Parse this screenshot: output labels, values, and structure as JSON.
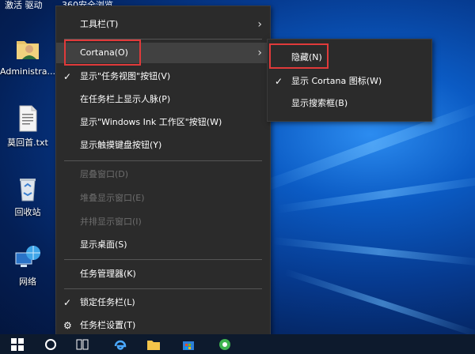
{
  "desktop": {
    "top_labels": [
      "激活 驱动",
      "360安全浏览"
    ],
    "icons": [
      {
        "label": "Administra..."
      },
      {
        "label": "莫回首.txt"
      },
      {
        "label": "回收站"
      },
      {
        "label": "网络"
      }
    ]
  },
  "context_menu": {
    "items": [
      {
        "label": "工具栏(T)",
        "submenu": true
      },
      {
        "label": "Cortana(O)",
        "submenu": true,
        "highlighted": true
      },
      {
        "label": "显示\"任务视图\"按钮(V)",
        "checked": true
      },
      {
        "label": "在任务栏上显示人脉(P)"
      },
      {
        "label": "显示\"Windows Ink 工作区\"按钮(W)"
      },
      {
        "label": "显示触摸键盘按钮(Y)"
      },
      {
        "label": "层叠窗口(D)",
        "disabled": true
      },
      {
        "label": "堆叠显示窗口(E)",
        "disabled": true
      },
      {
        "label": "并排显示窗口(I)",
        "disabled": true
      },
      {
        "label": "显示桌面(S)"
      },
      {
        "label": "任务管理器(K)"
      },
      {
        "label": "锁定任务栏(L)",
        "checked": true
      },
      {
        "label": "任务栏设置(T)",
        "icon": "gear-icon"
      }
    ]
  },
  "cortana_submenu": {
    "items": [
      {
        "label": "隐藏(N)"
      },
      {
        "label": "显示 Cortana 图标(W)",
        "checked": true
      },
      {
        "label": "显示搜索框(B)"
      }
    ]
  },
  "glyphs": {
    "check": "✓",
    "arrow": "›",
    "gear": "⚙"
  },
  "colors": {
    "menu_bg": "#2b2b2b",
    "menu_highlight": "#414141",
    "annotation_red": "#e03a3a",
    "disabled_text": "#6d6d6d"
  }
}
